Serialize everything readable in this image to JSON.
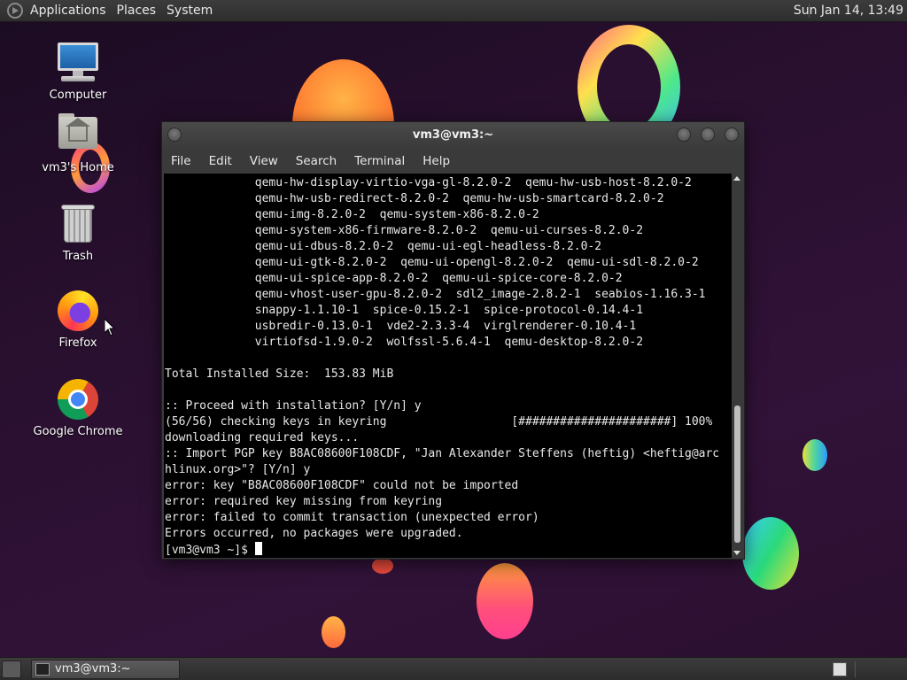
{
  "top_panel": {
    "menus": [
      "Applications",
      "Places",
      "System"
    ],
    "clock": "Sun Jan 14, 13:49"
  },
  "desktop_icons": [
    {
      "label": "Computer",
      "icon": "computer-icon"
    },
    {
      "label": "vm3's Home",
      "icon": "home-folder-icon"
    },
    {
      "label": "Trash",
      "icon": "trash-icon"
    },
    {
      "label": "Firefox",
      "icon": "firefox-icon"
    },
    {
      "label": "Google Chrome",
      "icon": "chrome-icon"
    }
  ],
  "terminal": {
    "title": "vm3@vm3:~",
    "menu": [
      "File",
      "Edit",
      "View",
      "Search",
      "Terminal",
      "Help"
    ],
    "output": "             qemu-hw-display-virtio-vga-gl-8.2.0-2  qemu-hw-usb-host-8.2.0-2\n             qemu-hw-usb-redirect-8.2.0-2  qemu-hw-usb-smartcard-8.2.0-2\n             qemu-img-8.2.0-2  qemu-system-x86-8.2.0-2\n             qemu-system-x86-firmware-8.2.0-2  qemu-ui-curses-8.2.0-2\n             qemu-ui-dbus-8.2.0-2  qemu-ui-egl-headless-8.2.0-2\n             qemu-ui-gtk-8.2.0-2  qemu-ui-opengl-8.2.0-2  qemu-ui-sdl-8.2.0-2\n             qemu-ui-spice-app-8.2.0-2  qemu-ui-spice-core-8.2.0-2\n             qemu-vhost-user-gpu-8.2.0-2  sdl2_image-2.8.2-1  seabios-1.16.3-1\n             snappy-1.1.10-1  spice-0.15.2-1  spice-protocol-0.14.4-1\n             usbredir-0.13.0-1  vde2-2.3.3-4  virglrenderer-0.10.4-1\n             virtiofsd-1.9.0-2  wolfssl-5.6.4-1  qemu-desktop-8.2.0-2\n\nTotal Installed Size:  153.83 MiB\n\n:: Proceed with installation? [Y/n] y\n(56/56) checking keys in keyring                  [######################] 100%\ndownloading required keys...\n:: Import PGP key B8AC08600F108CDF, \"Jan Alexander Steffens (heftig) <heftig@arc\nhlinux.org>\"? [Y/n] y\nerror: key \"B8AC08600F108CDF\" could not be imported\nerror: required key missing from keyring\nerror: failed to commit transaction (unexpected error)\nErrors occurred, no packages were upgraded.",
    "prompt": "[vm3@vm3 ~]$ "
  },
  "bottom_panel": {
    "task_label": "vm3@vm3:~"
  }
}
